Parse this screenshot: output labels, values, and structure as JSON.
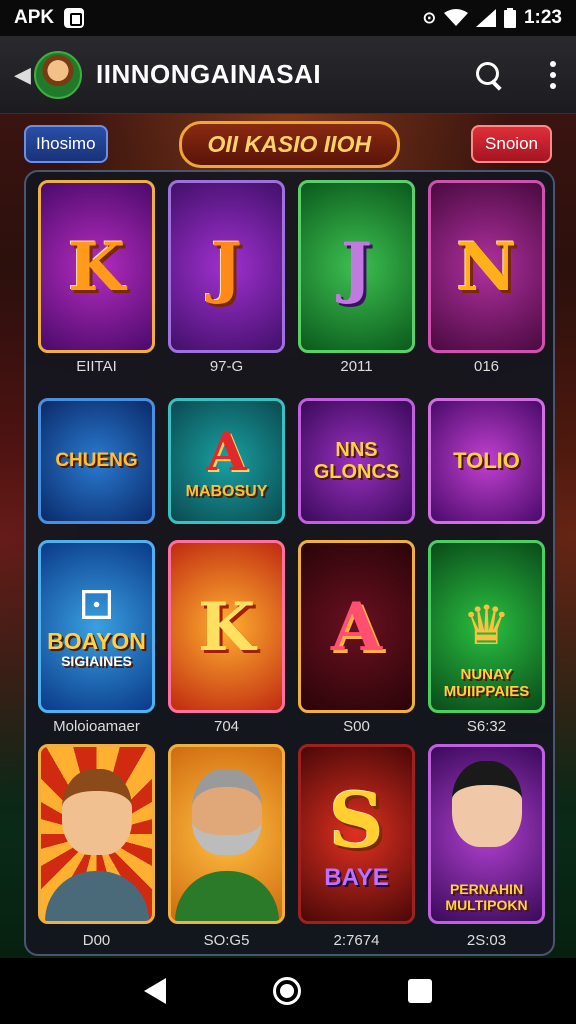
{
  "status_bar": {
    "carrier": "APK",
    "time": "1:23",
    "icons": [
      "apk-notification-icon",
      "location-icon",
      "wifi-icon",
      "signal-icon",
      "battery-icon"
    ]
  },
  "app_bar": {
    "title": "IINNONGAINASAI",
    "icons": [
      "back-icon",
      "avatar",
      "search-icon",
      "more-vert-icon"
    ]
  },
  "top_strip": {
    "left_button": "Ihosimo",
    "center_banner": "OII KASIO IIOH",
    "right_button": "Snoion"
  },
  "games": [
    {
      "label": "K",
      "caption": "ΕΙΙΤΑΙ",
      "style": "letter"
    },
    {
      "label": "J",
      "caption": "97-G",
      "style": "letter"
    },
    {
      "label": "J",
      "caption": "2011",
      "style": "letter"
    },
    {
      "label": "N",
      "caption": "016",
      "style": "letter"
    },
    {
      "label": "CHUENG",
      "caption": "",
      "style": "word"
    },
    {
      "label": "A",
      "sub": "MABOSUY",
      "caption": "",
      "style": "letter-sub"
    },
    {
      "label": "NNS GLONCS",
      "caption": "",
      "style": "word"
    },
    {
      "label": "TOLIO",
      "caption": "",
      "style": "word"
    },
    {
      "label": "BOAYON",
      "sub": "SIGIAINES",
      "caption": "Moloioamaer",
      "style": "word-sub"
    },
    {
      "label": "K",
      "caption": "704",
      "style": "letter"
    },
    {
      "label": "A",
      "caption": "S00",
      "style": "letter"
    },
    {
      "label": "NUNAY MUIIPPAIES",
      "caption": "S6:32",
      "style": "word"
    },
    {
      "label": "",
      "caption": "D00",
      "style": "person"
    },
    {
      "label": "",
      "caption": "SO:G5",
      "style": "person"
    },
    {
      "label": "S",
      "sub": "BAYE",
      "caption": "2:7674",
      "style": "letter-sub"
    },
    {
      "label": "PERNAHIN MULTIPOKN",
      "caption": "2S:03",
      "style": "person-text"
    }
  ],
  "colors": {
    "app_bar": "#2a2a2e",
    "panel_border": "#4a5670",
    "tile_gold": "#f0b040",
    "accent_red": "#e0303a",
    "accent_blue": "#2a4fa8"
  },
  "nav_bar": {
    "icons": [
      "nav-back-icon",
      "nav-home-icon",
      "nav-recent-icon"
    ]
  }
}
